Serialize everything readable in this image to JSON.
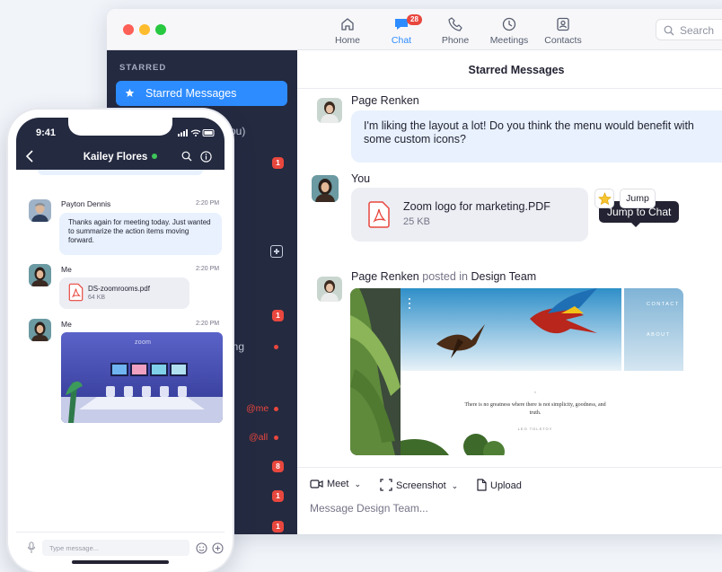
{
  "desktop": {
    "nav": [
      {
        "label": "Home",
        "icon": "home-icon"
      },
      {
        "label": "Chat",
        "icon": "chat-icon",
        "badge": "28"
      },
      {
        "label": "Phone",
        "icon": "phone-icon"
      },
      {
        "label": "Meetings",
        "icon": "clock-icon"
      },
      {
        "label": "Contacts",
        "icon": "contacts-icon"
      }
    ],
    "search_placeholder": "Search",
    "sidebar": {
      "section_label": "STARRED",
      "active_item": "Starred Messages",
      "partial_texts": [
        "ou)",
        "ing"
      ],
      "badges": [
        "1",
        "1",
        "8",
        "1",
        "1"
      ],
      "mentions": [
        "@me",
        "@all"
      ]
    },
    "main": {
      "title": "Starred Messages",
      "messages": [
        {
          "sender": "Page Renken",
          "text": "I'm liking the layout a lot! Do you think the menu would benefit with some custom icons?"
        },
        {
          "sender": "You",
          "file_name": "Zoom logo for marketing.PDF",
          "file_size": "25 KB"
        },
        {
          "sender": "Page Renken",
          "posted_in": "posted in",
          "channel": "Design Team",
          "image": {
            "menu_contact": "CONTACT",
            "menu_about": "ABOUT",
            "quote_mark": "“",
            "quote": "There is no greatness where there is not simplicity, goodness, and truth.",
            "author": "LEO TOLSTOY"
          }
        }
      ],
      "tooltip": "Jump to Chat",
      "jump_label": "Jump"
    },
    "composer": {
      "tools": [
        {
          "label": "Meet",
          "has_dropdown": true
        },
        {
          "label": "Screenshot",
          "has_dropdown": true
        },
        {
          "label": "Upload",
          "has_dropdown": false
        }
      ],
      "placeholder": "Message Design Team..."
    }
  },
  "phone": {
    "time": "9:41",
    "contact_name": "Kailey Flores",
    "messages": [
      {
        "sender": "Payton Dennis",
        "time": "2:20 PM",
        "text": "Thanks again for meeting today. Just wanted to summarize the action items moving forward."
      },
      {
        "sender": "Me",
        "time": "2:20 PM",
        "file_name": "DS-zoomrooms.pdf",
        "file_size": "64 KB"
      },
      {
        "sender": "Me",
        "time": "2:20 PM",
        "photo_logo": "zoom"
      }
    ],
    "input_placeholder": "Type message..."
  },
  "colors": {
    "accent": "#2d8cff",
    "sidebar_bg": "#242a40",
    "badge": "#e8473e",
    "bubble": "#e8f1fd",
    "online": "#3ec55b"
  }
}
